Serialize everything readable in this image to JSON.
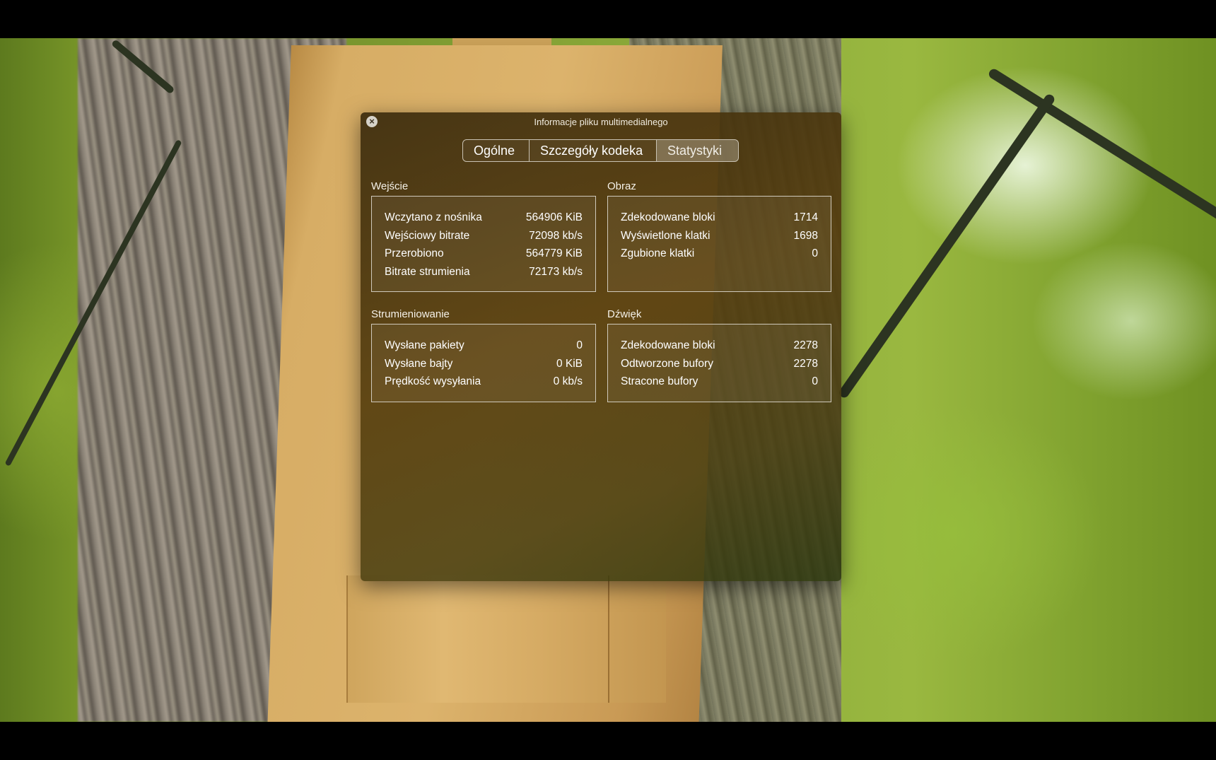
{
  "window": {
    "title": "Informacje pliku multimedialnego",
    "close_icon": "close-icon"
  },
  "tabs": [
    {
      "label": "Ogólne",
      "active": false
    },
    {
      "label": "Szczegóły kodeka",
      "active": false
    },
    {
      "label": "Statystyki",
      "active": true
    }
  ],
  "input": {
    "title": "Wejście",
    "rows": [
      {
        "label": "Wczytano z nośnika",
        "value": "564906 KiB"
      },
      {
        "label": "Wejściowy bitrate",
        "value": "72098 kb/s"
      },
      {
        "label": "Przerobiono",
        "value": "564779 KiB"
      },
      {
        "label": "Bitrate strumienia",
        "value": "72173 kb/s"
      }
    ]
  },
  "video": {
    "title": "Obraz",
    "rows": [
      {
        "label": "Zdekodowane bloki",
        "value": "1714"
      },
      {
        "label": "Wyświetlone klatki",
        "value": "1698"
      },
      {
        "label": "Zgubione klatki",
        "value": "0"
      }
    ]
  },
  "streaming": {
    "title": "Strumieniowanie",
    "rows": [
      {
        "label": "Wysłane pakiety",
        "value": "0"
      },
      {
        "label": "Wysłane bajty",
        "value": "0 KiB"
      },
      {
        "label": "Prędkość wysyłania",
        "value": "0 kb/s"
      }
    ]
  },
  "audio": {
    "title": "Dźwięk",
    "rows": [
      {
        "label": "Zdekodowane bloki",
        "value": "2278"
      },
      {
        "label": "Odtworzone bufory",
        "value": "2278"
      },
      {
        "label": "Stracone bufory",
        "value": "0"
      }
    ]
  }
}
